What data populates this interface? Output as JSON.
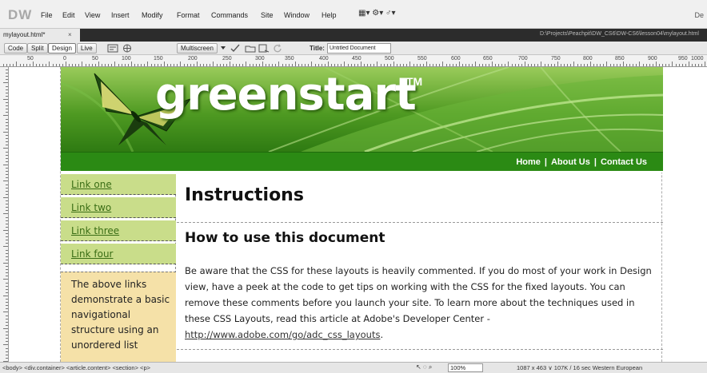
{
  "app": {
    "logo": "DW",
    "menus": [
      "File",
      "Edit",
      "View",
      "Insert",
      "Modify",
      "Format",
      "Commands",
      "Site",
      "Window",
      "Help"
    ],
    "tool_glyphs": "▦▾   ⚙▾   ♂▾",
    "right_text": "De"
  },
  "document_tab": {
    "name": "mylayout.html*",
    "close": "×",
    "path": "D:\\Projects\\Peachpit\\DW_CS6\\DW-CS6\\lesson04\\mylayout.html"
  },
  "toolbar": {
    "code": "Code",
    "split": "Split",
    "design": "Design",
    "live": "Live",
    "multiscreen": "Multiscreen",
    "title_label": "Title:",
    "title_value": "Untitled Document"
  },
  "ruler": {
    "labels": [
      "50",
      "0",
      "50",
      "100",
      "150",
      "200",
      "250",
      "300",
      "350",
      "400",
      "450",
      "500",
      "550",
      "600",
      "650",
      "700",
      "750",
      "800",
      "850",
      "900",
      "950",
      "1000"
    ]
  },
  "page": {
    "brand": "greenstart",
    "brand_tm": "TM",
    "nav": [
      "Home",
      "About Us",
      "Contact Us"
    ],
    "nav_sep": "|",
    "sidebar_links": [
      "Link one",
      "Link two",
      "Link three",
      "Link four"
    ],
    "sidebar_note": "The above links demonstrate a basic navigational structure using an unordered list",
    "h1": "Instructions",
    "h2": "How to use this document",
    "paragraph": "Be aware that the CSS for these layouts is heavily commented. If you do most of your work in Design view, have a peek at the code to get tips on working with the CSS for the fixed layouts. You can remove these comments before you launch your site. To learn more about the techniques used in these CSS Layouts, read this article at Adobe's Developer Center - ",
    "paragraph_link": "http://www.adobe.com/go/adc_css_layouts",
    "paragraph_end": "."
  },
  "status": {
    "tag_selector": "<body> <div.container> <article.content> <section> <p>",
    "tools": "↖ ◌ ⌕",
    "zoom": "100%",
    "info": "1087 x 463 ∨  107K / 16 sec  Western European"
  },
  "colors": {
    "nav_green": "#2b8a14",
    "sidebar_link_bg": "#c9dd8a",
    "sidebar_note_bg": "#f5e1a8"
  }
}
